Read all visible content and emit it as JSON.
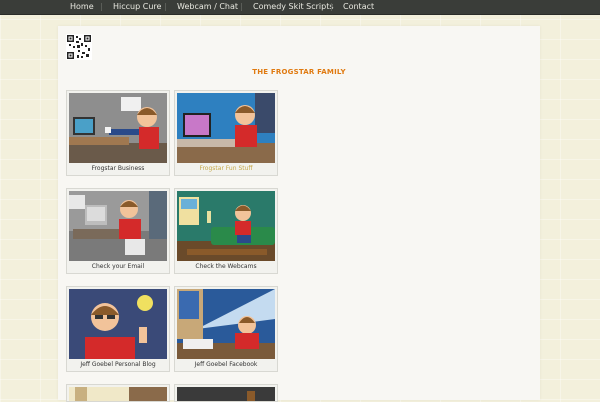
{
  "nav": {
    "items": [
      {
        "label": "Home"
      },
      {
        "label": "Hiccup Cure"
      },
      {
        "label": "Webcam / Chat"
      },
      {
        "label": "Comedy Skit Scripts"
      },
      {
        "label": "Contact"
      }
    ]
  },
  "main": {
    "title": "THE FROGSTAR FAMILY",
    "qr_icon": "qr-code-icon",
    "cards": [
      {
        "caption": "Frogstar Business"
      },
      {
        "caption": "Frogstar Fun Stuff"
      },
      {
        "caption": "Check your Email"
      },
      {
        "caption": "Check the Webcams"
      },
      {
        "caption": "Jeff Goebel Personal Blog"
      },
      {
        "caption": "Jeff Goebel Facebook"
      }
    ]
  },
  "colors": {
    "nav_bg": "#3a3d39",
    "title": "#e07a10",
    "highlight_caption": "#c6a94a"
  }
}
